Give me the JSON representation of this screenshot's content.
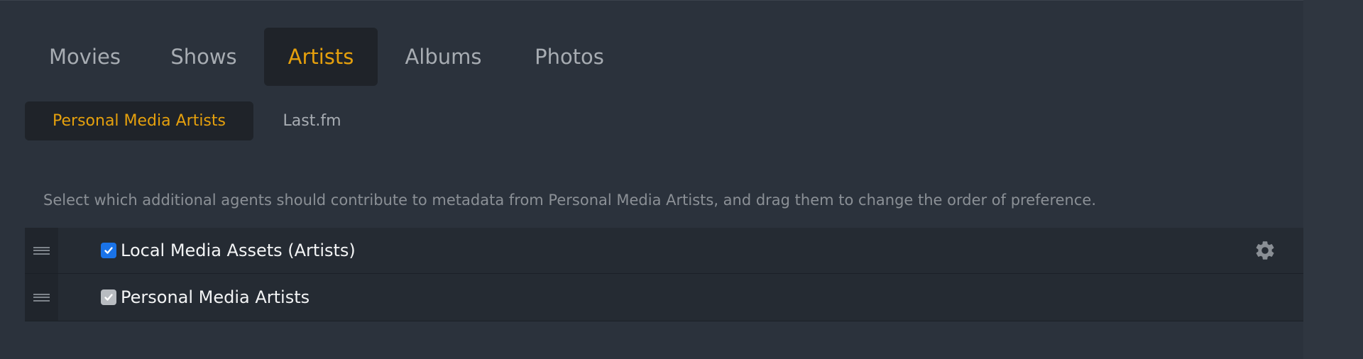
{
  "colors": {
    "background": "#2b323c",
    "accent": "#e5a00d",
    "tab_text": "#a7acb2",
    "active_tab_bg": "#1f2329",
    "row_bg": "#252b33",
    "checkbox_checked": "#1a73e8"
  },
  "main_tabs": [
    {
      "label": "Movies",
      "active": false
    },
    {
      "label": "Shows",
      "active": false
    },
    {
      "label": "Artists",
      "active": true
    },
    {
      "label": "Albums",
      "active": false
    },
    {
      "label": "Photos",
      "active": false
    }
  ],
  "sub_tabs": [
    {
      "label": "Personal Media Artists",
      "active": true
    },
    {
      "label": "Last.fm",
      "active": false
    }
  ],
  "description": "Select which additional agents should contribute to metadata from Personal Media Artists, and drag them to change the order of preference.",
  "agents": [
    {
      "name": "Local Media Assets (Artists)",
      "checked": true,
      "disabled": false,
      "drag_icon": "drag-handle-icon",
      "settings_icon": "gear-icon"
    },
    {
      "name": "Personal Media Artists",
      "checked": true,
      "disabled": true,
      "drag_icon": "drag-handle-icon"
    }
  ]
}
